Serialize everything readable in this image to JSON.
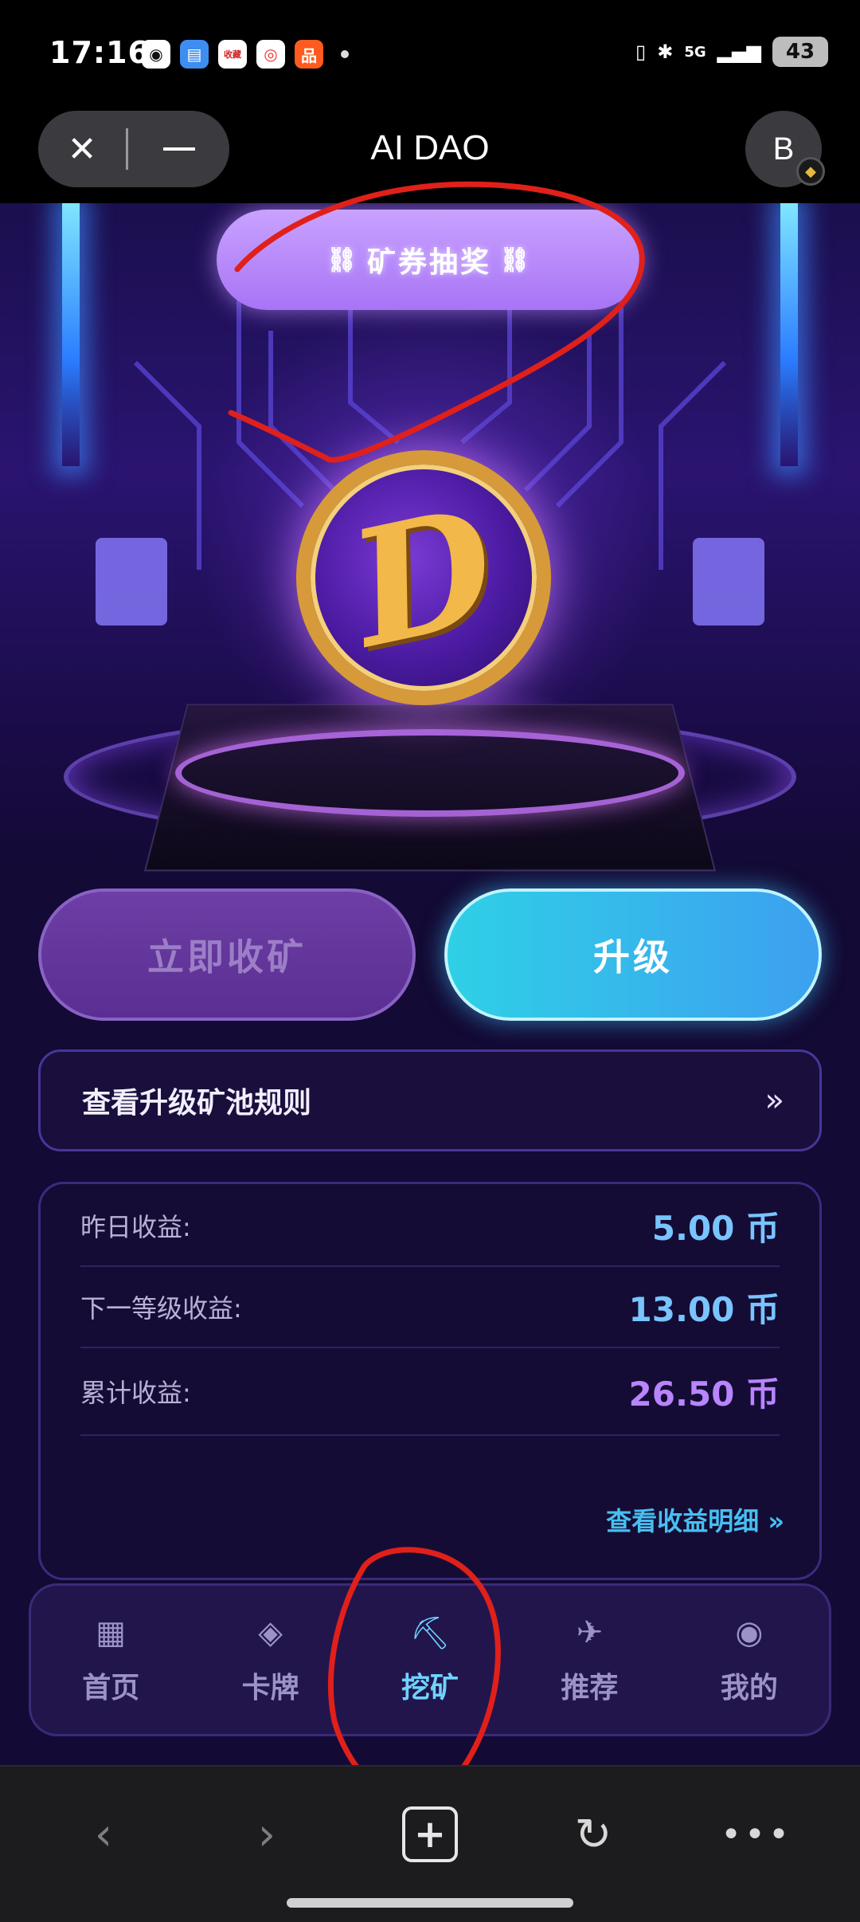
{
  "status_bar": {
    "time": "17:16",
    "app_icons": [
      "qq-icon",
      "wallet-icon",
      "news-icon",
      "weibo-icon",
      "taobao-icon"
    ],
    "news_icon_text": "收藏",
    "network": "5G",
    "battery": "43"
  },
  "titlebar": {
    "title": "AI DAO",
    "avatar_letter": "B"
  },
  "hero": {
    "lottery_label": "矿券抽奖",
    "coin_letter": "D"
  },
  "actions": {
    "collect_label": "立即收矿",
    "upgrade_label": "升级"
  },
  "rules": {
    "label": "查看升级矿池规则",
    "chevron": "»"
  },
  "earnings": {
    "rows": [
      {
        "label": "昨日收益:",
        "value": "5.00 币"
      },
      {
        "label": "下一等级收益:",
        "value": "13.00 币"
      },
      {
        "label": "累计收益:",
        "value": "26.50 币"
      }
    ],
    "detail_link": "查看收益明细 »"
  },
  "nav": {
    "items": [
      {
        "label": "首页",
        "icon": "grid-icon",
        "active": false
      },
      {
        "label": "卡牌",
        "icon": "diamond-icon",
        "active": false
      },
      {
        "label": "挖矿",
        "icon": "pickaxe-icon",
        "active": true
      },
      {
        "label": "推荐",
        "icon": "plane-icon",
        "active": false
      },
      {
        "label": "我的",
        "icon": "profile-circle-icon",
        "active": false
      }
    ]
  },
  "browser": {
    "buttons": [
      "back-icon",
      "forward-icon",
      "new-tab-icon",
      "reload-icon",
      "more-icon"
    ]
  },
  "colors": {
    "accent_blue": "#6fd3ff",
    "accent_purple": "#b884ff",
    "annotation_red": "#e0201a"
  }
}
